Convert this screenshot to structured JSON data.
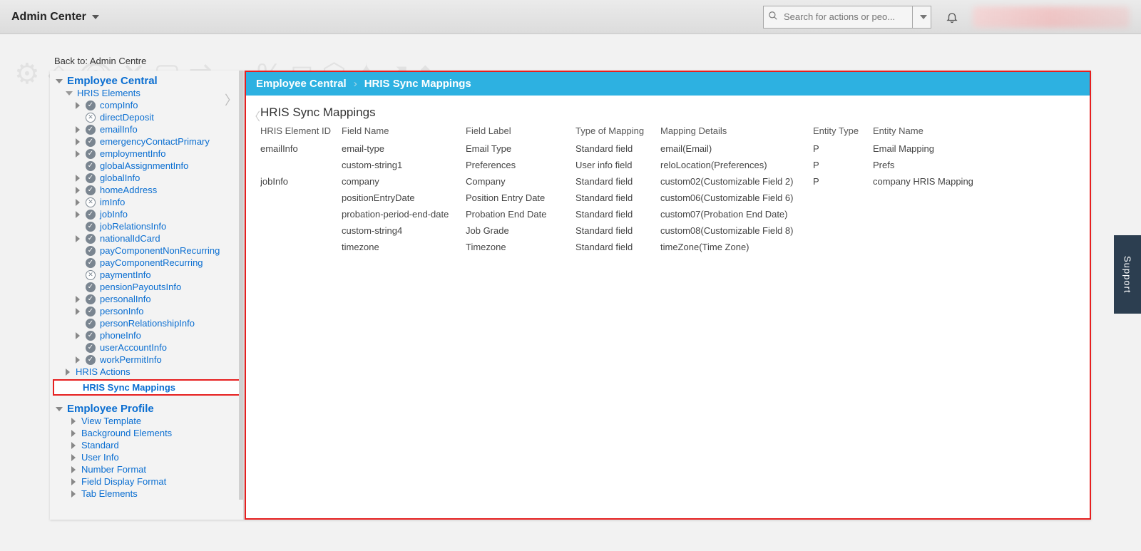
{
  "header": {
    "appTitle": "Admin Center",
    "searchPlaceholder": "Search for actions or peo..."
  },
  "backLink": {
    "prefix": "Back to: ",
    "target": "Admin Centre"
  },
  "sidebar": {
    "section1": {
      "title": "Employee Central",
      "hrisElementsLabel": "HRIS Elements",
      "elements": [
        {
          "label": "compInfo",
          "status": "ok",
          "expandable": true
        },
        {
          "label": "directDeposit",
          "status": "x",
          "expandable": false
        },
        {
          "label": "emailInfo",
          "status": "ok",
          "expandable": true
        },
        {
          "label": "emergencyContactPrimary",
          "status": "ok",
          "expandable": true
        },
        {
          "label": "employmentInfo",
          "status": "ok",
          "expandable": true
        },
        {
          "label": "globalAssignmentInfo",
          "status": "ok",
          "expandable": false
        },
        {
          "label": "globalInfo",
          "status": "ok",
          "expandable": true
        },
        {
          "label": "homeAddress",
          "status": "ok",
          "expandable": true
        },
        {
          "label": "imInfo",
          "status": "x",
          "expandable": true
        },
        {
          "label": "jobInfo",
          "status": "ok",
          "expandable": true
        },
        {
          "label": "jobRelationsInfo",
          "status": "ok",
          "expandable": false
        },
        {
          "label": "nationalIdCard",
          "status": "ok",
          "expandable": true
        },
        {
          "label": "payComponentNonRecurring",
          "status": "ok",
          "expandable": false
        },
        {
          "label": "payComponentRecurring",
          "status": "ok",
          "expandable": false
        },
        {
          "label": "paymentInfo",
          "status": "x",
          "expandable": false
        },
        {
          "label": "pensionPayoutsInfo",
          "status": "ok",
          "expandable": false
        },
        {
          "label": "personalInfo",
          "status": "ok",
          "expandable": true
        },
        {
          "label": "personInfo",
          "status": "ok",
          "expandable": true
        },
        {
          "label": "personRelationshipInfo",
          "status": "ok",
          "expandable": false
        },
        {
          "label": "phoneInfo",
          "status": "ok",
          "expandable": true
        },
        {
          "label": "userAccountInfo",
          "status": "ok",
          "expandable": false
        },
        {
          "label": "workPermitInfo",
          "status": "ok",
          "expandable": true
        }
      ],
      "hrisActionsLabel": "HRIS Actions",
      "hrisSyncMappingsLabel": "HRIS Sync Mappings"
    },
    "section2": {
      "title": "Employee Profile",
      "items": [
        "View Template",
        "Background Elements",
        "Standard",
        "User Info",
        "Number Format",
        "Field Display Format",
        "Tab Elements"
      ]
    }
  },
  "breadcrumb": {
    "root": "Employee Central",
    "leaf": "HRIS Sync Mappings"
  },
  "contentTitle": "HRIS Sync Mappings",
  "tableHeaders": [
    "HRIS Element ID",
    "Field Name",
    "Field Label",
    "Type of Mapping",
    "Mapping Details",
    "Entity Type",
    "Entity Name"
  ],
  "rows": [
    {
      "elId": "emailInfo",
      "field": "email-type",
      "label": "Email Type",
      "type": "Standard field",
      "details": "email(Email)",
      "etype": "P",
      "ename": "Email Mapping"
    },
    {
      "elId": "",
      "field": "custom-string1",
      "label": "Preferences",
      "type": "User info field",
      "details": "reloLocation(Preferences)",
      "etype": "P",
      "ename": "Prefs"
    },
    {
      "elId": "jobInfo",
      "field": "company",
      "label": "Company",
      "type": "Standard field",
      "details": "custom02(Customizable Field 2)",
      "etype": "P",
      "ename": "company HRIS Mapping"
    },
    {
      "elId": "",
      "field": "positionEntryDate",
      "label": "Position Entry Date",
      "type": "Standard field",
      "details": "custom06(Customizable Field 6)",
      "etype": "",
      "ename": ""
    },
    {
      "elId": "",
      "field": "probation-period-end-date",
      "label": "Probation End Date",
      "type": "Standard field",
      "details": "custom07(Probation End Date)",
      "etype": "",
      "ename": ""
    },
    {
      "elId": "",
      "field": "custom-string4",
      "label": "Job Grade",
      "type": "Standard field",
      "details": "custom08(Customizable Field 8)",
      "etype": "",
      "ename": ""
    },
    {
      "elId": "",
      "field": "timezone",
      "label": "Timezone",
      "type": "Standard field",
      "details": "timeZone(Time Zone)",
      "etype": "",
      "ename": ""
    }
  ],
  "supportLabel": "Support"
}
